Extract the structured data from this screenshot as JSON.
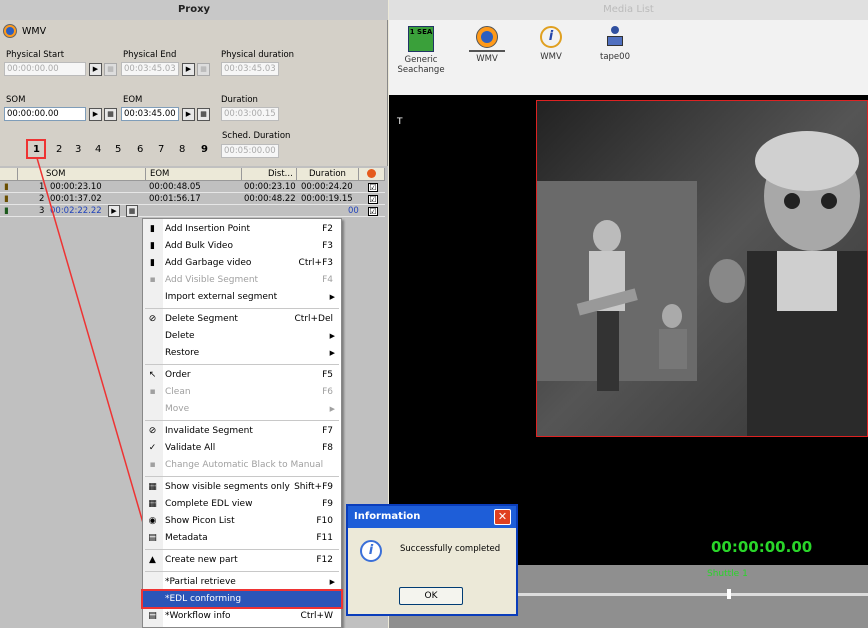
{
  "proxy": {
    "title": "Proxy",
    "media_name": "WMV",
    "physical_start_label": "Physical Start",
    "physical_start_value": "00:00:00.00",
    "physical_end_label": "Physical End",
    "physical_end_value": "00:03:45.03",
    "physical_duration_label": "Physical duration",
    "physical_duration_value": "00:03:45.03",
    "som_label": "SOM",
    "som_value": "00:00:00.00",
    "eom_label": "EOM",
    "eom_value": "00:03:45.00",
    "duration_label": "Duration",
    "duration_value": "00:03:00.15",
    "sched_duration_label": "Sched. Duration",
    "sched_duration_value": "00:05:00.00",
    "pages": [
      "1",
      "2",
      "3",
      "4",
      "5",
      "6",
      "7",
      "8",
      "9"
    ],
    "active_page": "1"
  },
  "grid": {
    "headers": [
      "SOM",
      "EOM",
      "Dist...",
      "Duration"
    ],
    "rows": [
      {
        "index": "1",
        "som": "00:00:23.10",
        "eom": "00:00:48.05",
        "dist": "00:00:23.10",
        "duration": "00:00:24.20",
        "checked": "☑"
      },
      {
        "index": "2",
        "som": "00:01:37.02",
        "eom": "00:01:56.17",
        "dist": "00:00:48.22",
        "duration": "00:00:19.15",
        "checked": "☑"
      },
      {
        "index": "3",
        "som": "00:02:22.22",
        "eom": "",
        "dist": "",
        "duration": "00",
        "checked": "☑"
      }
    ]
  },
  "context_menu": {
    "items": [
      {
        "label": "Add Insertion Point",
        "shortcut": "F2",
        "icon": "insertion-point-icon",
        "glyph": "▮",
        "disabled": false
      },
      {
        "label": "Add Bulk Video",
        "shortcut": "F3",
        "icon": "bulk-video-icon",
        "glyph": "▮",
        "disabled": false
      },
      {
        "label": "Add Garbage video",
        "shortcut": "Ctrl+F3",
        "icon": "garbage-video-icon",
        "glyph": "▮",
        "disabled": false
      },
      {
        "label": "Add Visible Segment",
        "shortcut": "F4",
        "icon": "visible-segment-icon",
        "glyph": "▪",
        "disabled": true
      },
      {
        "label": "Import external segment",
        "shortcut": "",
        "submenu": true,
        "disabled": false
      },
      {
        "sep": true
      },
      {
        "label": "Delete Segment",
        "shortcut": "Ctrl+Del",
        "icon": "delete-segment-icon",
        "glyph": "⊘",
        "disabled": false
      },
      {
        "label": "Delete",
        "shortcut": "",
        "submenu": true,
        "disabled": false
      },
      {
        "label": "Restore",
        "shortcut": "",
        "submenu": true,
        "disabled": false
      },
      {
        "sep": true
      },
      {
        "label": "Order",
        "shortcut": "F5",
        "icon": "order-icon",
        "glyph": "↖",
        "disabled": false
      },
      {
        "label": "Clean",
        "shortcut": "F6",
        "icon": "clean-icon",
        "glyph": "▪",
        "disabled": true
      },
      {
        "label": "Move",
        "shortcut": "",
        "submenu": true,
        "disabled": true
      },
      {
        "sep": true
      },
      {
        "label": "Invalidate Segment",
        "shortcut": "F7",
        "icon": "invalidate-icon",
        "glyph": "⊘",
        "disabled": false
      },
      {
        "label": "Validate All",
        "shortcut": "F8",
        "icon": "validate-all-icon",
        "glyph": "✓",
        "disabled": false
      },
      {
        "label": "Change Automatic Black to Manual",
        "shortcut": "",
        "icon": "black-manual-icon",
        "glyph": "▪",
        "disabled": true
      },
      {
        "sep": true
      },
      {
        "label": "Show visible segments only",
        "shortcut": "Shift+F9",
        "icon": "visible-only-icon",
        "glyph": "▦",
        "disabled": false
      },
      {
        "label": "Complete EDL view",
        "shortcut": "F9",
        "icon": "edl-view-icon",
        "glyph": "▦",
        "disabled": false
      },
      {
        "label": "Show Picon List",
        "shortcut": "F10",
        "icon": "picon-list-icon",
        "glyph": "◉",
        "disabled": false
      },
      {
        "label": "Metadata",
        "shortcut": "F11",
        "icon": "metadata-icon",
        "glyph": "▤",
        "disabled": false
      },
      {
        "sep": true
      },
      {
        "label": "Create new part",
        "shortcut": "F12",
        "icon": "new-part-icon",
        "glyph": "▲",
        "disabled": false
      },
      {
        "sep": true
      },
      {
        "label": "*Partial retrieve",
        "shortcut": "",
        "submenu": true,
        "disabled": false
      },
      {
        "label": "*EDL conforming",
        "shortcut": "",
        "highlighted": true,
        "disabled": false
      },
      {
        "label": "*Workflow info",
        "shortcut": "Ctrl+W",
        "icon": "workflow-info-icon",
        "glyph": "▤",
        "disabled": false
      }
    ]
  },
  "media_list": {
    "title": "Media List",
    "toolbar": [
      {
        "label": "Generic Seachange",
        "icon": "seachange-icon",
        "badge": "1 SEA"
      },
      {
        "label": "WMV",
        "icon": "wmv-play-icon"
      },
      {
        "label": "WMV",
        "icon": "info-icon"
      },
      {
        "label": "tape00",
        "icon": "tape-icon"
      }
    ],
    "marker": "T",
    "timecode": "00:00:00.00",
    "shuttle": "Shuttle 1"
  },
  "dialog": {
    "title": "Information",
    "message": "Successfully completed",
    "ok": "OK"
  },
  "colors": {
    "highlight": "#2b55b8",
    "annotation_red": "#e33",
    "timecode_green": "#29d629",
    "dialog_title": "#1e5ed8"
  }
}
